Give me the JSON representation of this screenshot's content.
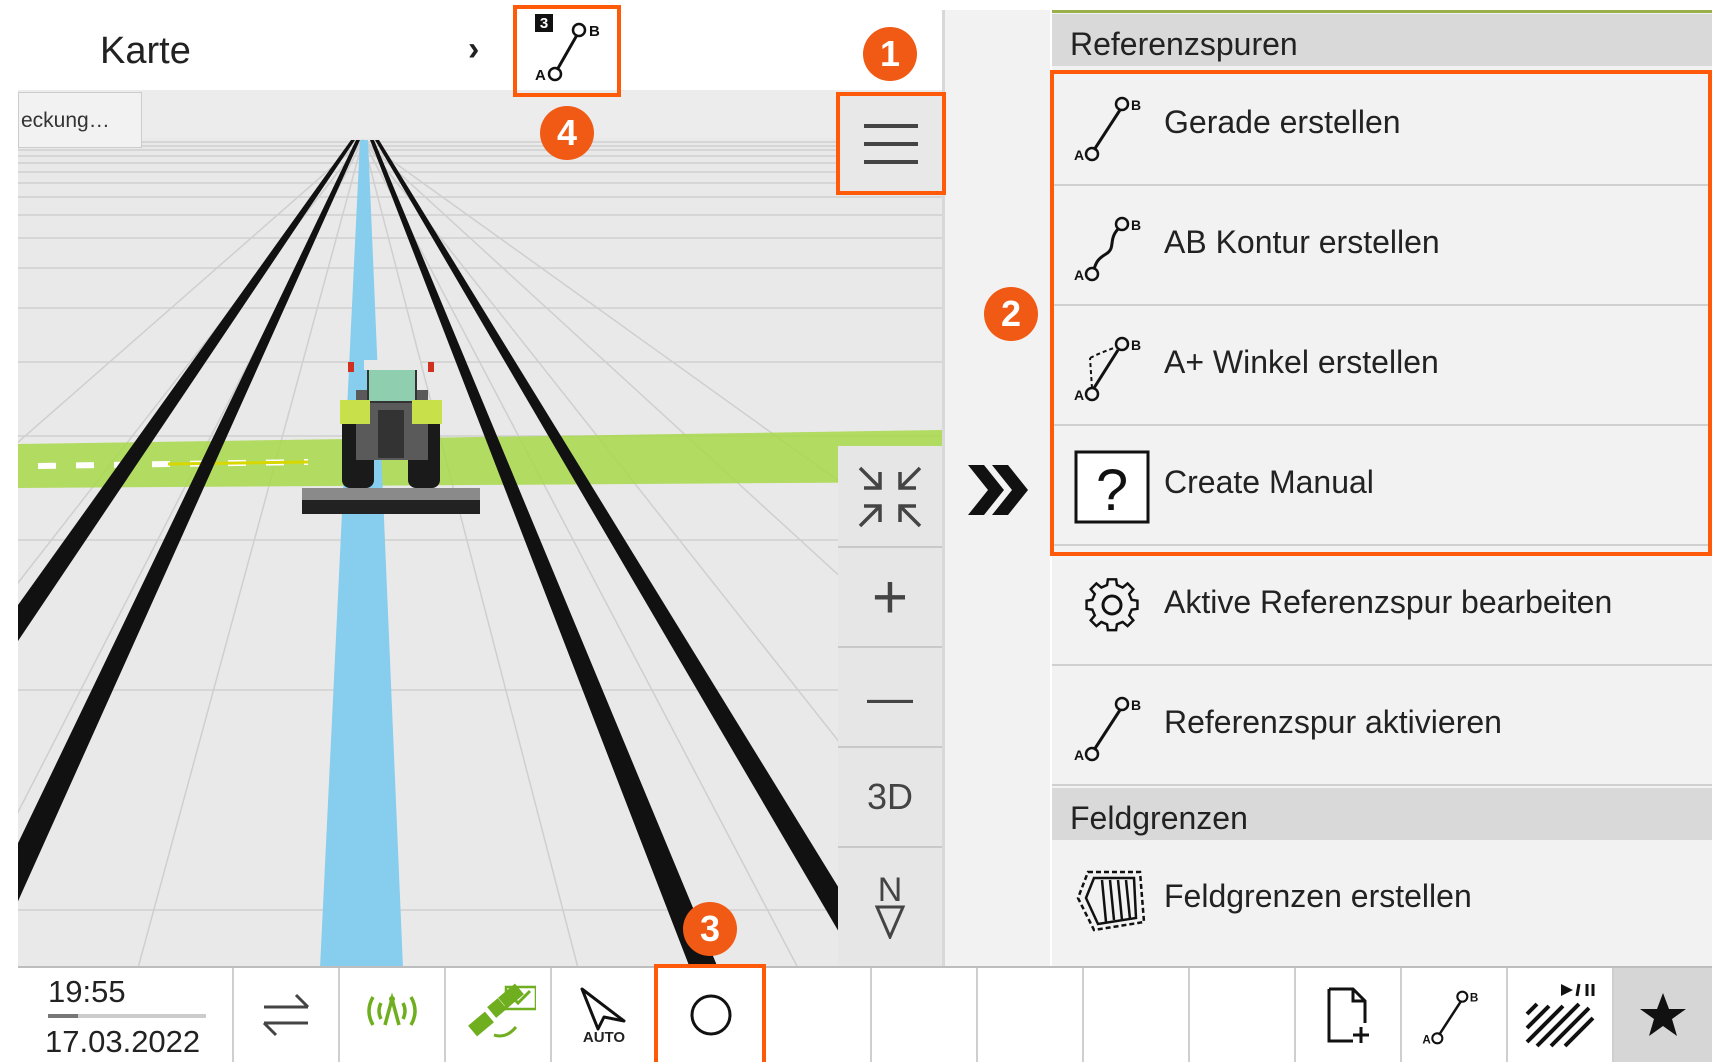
{
  "header": {
    "title": "Karte",
    "chevron": "›",
    "active_track_badge": "3",
    "active_track_icon": "ab-line-icon"
  },
  "map": {
    "coverage_button_label": "eckung…",
    "controls": {
      "zoom_fit_icon": "zoom-fit-icon",
      "zoom_in_label": "+",
      "zoom_out_label": "—",
      "view_3d_label": "3D",
      "north_label": "N"
    }
  },
  "panel": {
    "sections": [
      {
        "header": "Referenzspuren",
        "items": [
          {
            "label": "Gerade erstellen",
            "icon": "ab-straight-icon"
          },
          {
            "label": "AB Kontur erstellen",
            "icon": "ab-contour-icon"
          },
          {
            "label": "A+ Winkel erstellen",
            "icon": "a-plus-angle-icon"
          },
          {
            "label": "Create Manual",
            "icon": "question-icon"
          },
          {
            "label": "Aktive Referenzspur bearbeiten",
            "icon": "gear-icon"
          },
          {
            "label": "Referenzspur aktivieren",
            "icon": "ab-straight-icon"
          }
        ]
      },
      {
        "header": "Feldgrenzen",
        "items": [
          {
            "label": "Feldgrenzen erstellen",
            "icon": "field-boundary-icon"
          }
        ]
      }
    ]
  },
  "annotations": {
    "badge_1": "1",
    "badge_2": "2",
    "badge_3": "3",
    "badge_4": "4"
  },
  "statusbar": {
    "time": "19:55",
    "date": "17.03.2022",
    "time_progress": 0.19,
    "auto_label": "AUTO"
  },
  "colors": {
    "highlight": "#ff5a0a",
    "badge": "#f05a14",
    "guide_line": "#87cdee",
    "field_strip": "#a8d84a",
    "panel_bg": "#f2f2f2",
    "section_header_bg": "#d9d9d9",
    "gps_green": "#6fae1f"
  }
}
